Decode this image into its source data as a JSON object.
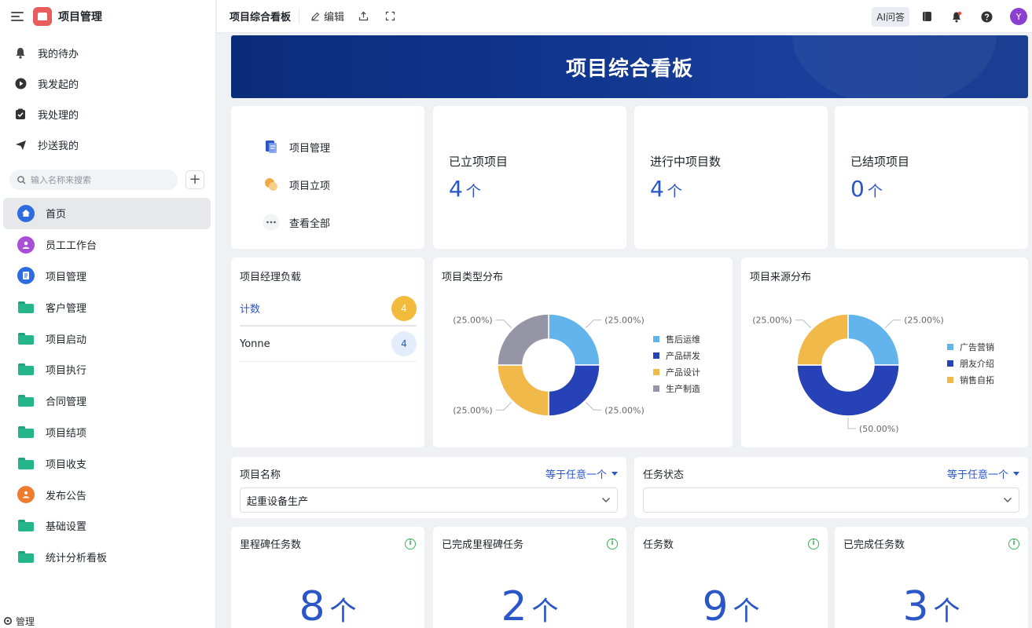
{
  "app": {
    "title": "项目管理"
  },
  "quick_items": [
    {
      "label": "我的待办",
      "icon": "bell-icon"
    },
    {
      "label": "我发起的",
      "icon": "play-circle-icon"
    },
    {
      "label": "我处理的",
      "icon": "check-clipboard-icon"
    },
    {
      "label": "抄送我的",
      "icon": "send-icon"
    }
  ],
  "search": {
    "placeholder": "输入名称来搜索",
    "add_label": "+"
  },
  "nav_items": [
    {
      "label": "首页",
      "icon": "home-icon",
      "active": true
    },
    {
      "label": "员工工作台",
      "icon": "person-icon"
    },
    {
      "label": "项目管理",
      "icon": "document-icon"
    },
    {
      "label": "客户管理",
      "icon": "folder-icon"
    },
    {
      "label": "项目启动",
      "icon": "folder-icon"
    },
    {
      "label": "项目执行",
      "icon": "folder-icon"
    },
    {
      "label": "合同管理",
      "icon": "folder-icon"
    },
    {
      "label": "项目结项",
      "icon": "folder-icon"
    },
    {
      "label": "项目收支",
      "icon": "folder-icon"
    },
    {
      "label": "发布公告",
      "icon": "announce-icon"
    },
    {
      "label": "基础设置",
      "icon": "folder-icon"
    },
    {
      "label": "统计分析看板",
      "icon": "folder-icon"
    }
  ],
  "sidebar_footer": {
    "label": "管理"
  },
  "topbar": {
    "title": "项目综合看板",
    "edit_label": "编辑",
    "ai_label": "AI问答",
    "avatar_letter": "Y"
  },
  "banner": {
    "title": "项目综合看板"
  },
  "links": [
    {
      "label": "项目管理",
      "icon": "project-doc-icon"
    },
    {
      "label": "项目立项",
      "icon": "project-start-icon"
    },
    {
      "label": "查看全部",
      "icon": "more-icon"
    }
  ],
  "stats": [
    {
      "label": "已立项项目",
      "value": "4",
      "unit": "个"
    },
    {
      "label": "进行中项目数",
      "value": "4",
      "unit": "个"
    },
    {
      "label": "已结项项目",
      "value": "0",
      "unit": "个"
    }
  ],
  "manager_load": {
    "title": "项目经理负载",
    "rows": [
      {
        "label": "计数",
        "value": "4"
      },
      {
        "label": "Yonne",
        "value": "4"
      }
    ]
  },
  "pie_type": {
    "title": "项目类型分布",
    "slices": [
      {
        "name": "售后运维",
        "value": 25,
        "label": "(25.00%)",
        "color": "#63b3ec"
      },
      {
        "name": "产品研发",
        "value": 25,
        "label": "(25.00%)",
        "color": "#2742b6"
      },
      {
        "name": "产品设计",
        "value": 25,
        "label": "(25.00%)",
        "color": "#f1b84a"
      },
      {
        "name": "生产制造",
        "value": 25,
        "label": "(25.00%)",
        "color": "#9595a6"
      }
    ]
  },
  "pie_source": {
    "title": "项目来源分布",
    "slices": [
      {
        "name": "广告营销",
        "value": 25,
        "label": "(25.00%)",
        "color": "#63b3ec"
      },
      {
        "name": "朋友介绍",
        "value": 50,
        "label": "(50.00%)",
        "color": "#2742b6"
      },
      {
        "name": "销售自拓",
        "value": 25,
        "label": "(25.00%)",
        "color": "#f1b84a"
      }
    ]
  },
  "filters": [
    {
      "label": "项目名称",
      "operator": "等于任意一个",
      "value": "起重设备生产"
    },
    {
      "label": "任务状态",
      "operator": "等于任意一个",
      "value": ""
    }
  ],
  "kpis": [
    {
      "label": "里程碑任务数",
      "value": "8",
      "unit": "个"
    },
    {
      "label": "已完成里程碑任务",
      "value": "2",
      "unit": "个"
    },
    {
      "label": "任务数",
      "value": "9",
      "unit": "个"
    },
    {
      "label": "已完成任务数",
      "value": "3",
      "unit": "个"
    }
  ],
  "colors": {
    "accent": "#2a56c8",
    "banner": "#10368f",
    "folder": "#25b58a"
  }
}
